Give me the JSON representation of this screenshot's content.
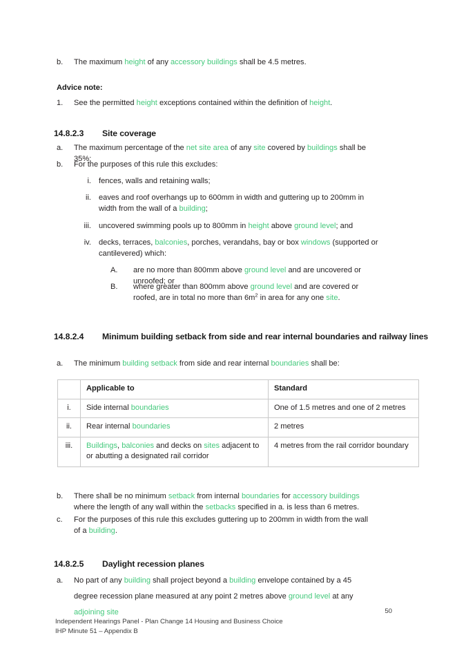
{
  "document": {
    "page_number": "50",
    "footer_line_1": "Independent Hearings Panel - Plan Change 14 Housing and Business Choice",
    "footer_line_2": "IHP Minute 51 – Appendix B",
    "link_color": "#44c97c",
    "text_color": "#231f20"
  },
  "blocks": {
    "clause_b_top": {
      "marker": "b.",
      "text_1": "The maximum ",
      "link_1": "height",
      "text_2": " of any ",
      "link_2": "accessory buildings",
      "text_3": " shall be 4.5 metres."
    },
    "advice_note": {
      "label": "Advice note:",
      "item_1": {
        "marker": "1.",
        "text_1": "See the permitted ",
        "link_1": "height",
        "text_2": " exceptions contained within the definition of ",
        "link_2": "height",
        "text_3": "."
      }
    },
    "section_site_coverage": {
      "number": "14.8.2.3",
      "title": "Site coverage",
      "a": {
        "marker": "a.",
        "text_1": "The maximum percentage of the ",
        "link_1": "net site area",
        "text_2": " of any ",
        "link_2": "site",
        "text_3": " covered by ",
        "link_3": "buildings",
        "text_4": " shall be 35%:"
      },
      "b": {
        "marker": "b.",
        "text_1": "For the purposes of this rule this excludes:"
      },
      "b_i": {
        "marker": "i.",
        "text_1": "fences, walls and retaining walls;"
      },
      "b_ii": {
        "marker": "ii.",
        "text_1": "eaves and roof overhangs up to 600mm in width and guttering up to 200mm in width from the wall of a ",
        "link_1": "building",
        "text_2": ";"
      },
      "b_iii": {
        "marker": "iii.",
        "text_1": "uncovered swimming pools up to 800mm in ",
        "link_1": "height",
        "text_2": " above ",
        "link_2": "ground level",
        "text_3": "; and"
      },
      "b_iv": {
        "marker": "iv.",
        "text_1": "decks, terraces, ",
        "link_1": "balconies",
        "text_2": ", porches, verandahs, bay or box ",
        "link_2": "windows",
        "text_3": " (supported or cantilevered) which:"
      },
      "b_iv_A": {
        "marker": "A.",
        "text_1": "are no more than 800mm above ",
        "link_1": "ground level",
        "text_2": " and are uncovered or unroofed; or"
      },
      "b_iv_B": {
        "marker": "B.",
        "text_1": "where greater than 800mm above ",
        "link_1": "ground level",
        "text_2": " and are covered or roofed, are in total no more than 6m",
        "sup_1": "2",
        "text_3": " in area for any one ",
        "link_2": "site",
        "text_4": "."
      }
    },
    "section_setback": {
      "number": "14.8.2.4",
      "title": "Minimum building setback from side and rear internal boundaries and railway lines",
      "a": {
        "marker": "a.",
        "text_1": "The minimum ",
        "link_1": "building setback",
        "text_2": " from side and rear internal ",
        "link_2": "boundaries",
        "text_3": " shall be:"
      },
      "table": {
        "headers": {
          "num": "",
          "applicable": "Applicable to",
          "standard": "Standard"
        },
        "rows": [
          {
            "num": "i.",
            "applicable": {
              "text_1": "Side internal ",
              "link_1": "boundaries",
              "text_2": ""
            },
            "standard": "One of 1.5 metres and one of 2 metres"
          },
          {
            "num": "ii.",
            "applicable": {
              "text_1": "Rear internal ",
              "link_1": "boundaries",
              "text_2": ""
            },
            "standard": "2 metres"
          },
          {
            "num": "iii.",
            "applicable": {
              "link_1": "Buildings",
              "text_1": ", ",
              "link_2": "balconies",
              "text_2": " and decks on ",
              "link_3": "sites",
              "text_3": " adjacent to or abutting a designated rail corridor"
            },
            "standard": "4 metres from the rail corridor boundary"
          }
        ]
      },
      "b": {
        "marker": "b.",
        "text_1": "There shall be no minimum ",
        "link_1": "setback",
        "text_2": " from internal ",
        "link_2": "boundaries",
        "text_3": " for ",
        "link_3": "accessory buildings",
        "text_4": " where the length of any wall within the ",
        "link_4": "setbacks",
        "text_5": " specified in a. is less than 6 metres."
      },
      "c": {
        "marker": "c.",
        "text_1": "For the purposes of this rule this excludes guttering up to 200mm in width from the wall of a ",
        "link_1": "building",
        "text_2": "."
      }
    },
    "section_daylight": {
      "number": "14.8.2.5",
      "title": "Daylight recession planes",
      "a": {
        "marker": "a.",
        "text_1": "No part of any ",
        "link_1": "building",
        "text_2": " shall project beyond a ",
        "link_2": "building",
        "text_3": " envelope contained by a 45 degree recession plane measured at any point 2 metres above ",
        "link_3": "ground level",
        "text_4": " at any ",
        "link_4": "adjoining site"
      }
    }
  }
}
